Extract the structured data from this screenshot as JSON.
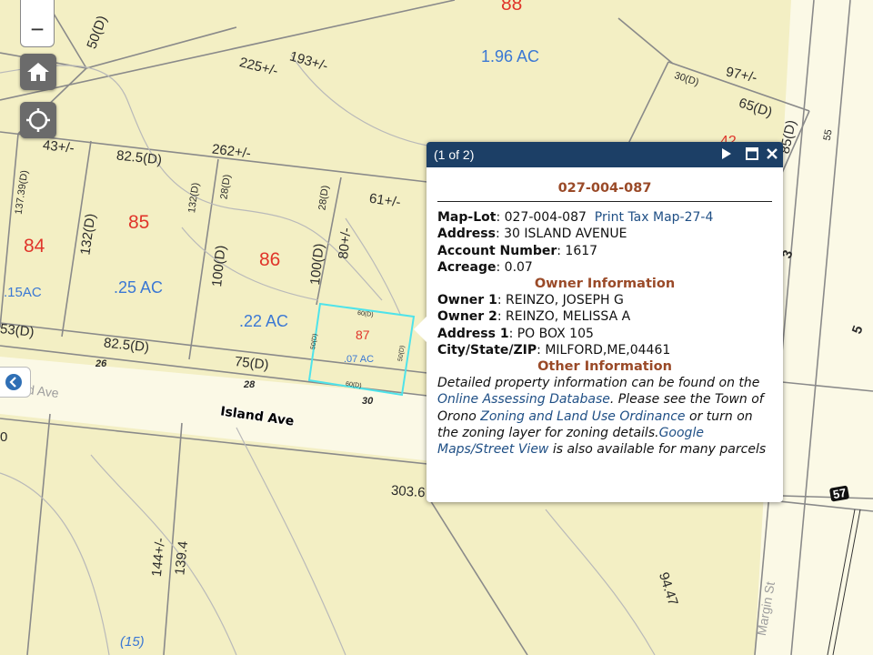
{
  "map": {
    "parcel_numbers": [
      "88",
      "85",
      "84",
      "86",
      "87",
      "42"
    ],
    "acreages": [
      "1.96 AC",
      ".25 AC",
      ".15AC",
      ".22 AC",
      ".07 AC"
    ],
    "dims": {
      "d50": "50(D)",
      "d193": "193+/-",
      "d225": "225+/-",
      "d97": "97+/-",
      "d30": "30(D)",
      "d65": "65(D)",
      "d85": "85(D)",
      "d55": "55",
      "d43": "43+/-",
      "d825a": "82.5(D)",
      "d262": "262+/-",
      "d13739": "137.39(D)",
      "d132a": "132(D)",
      "d132b": "132(D)",
      "d28a": "28(D)",
      "d28b": "28(D)",
      "d61": "61+/-",
      "d100a": "100(D)",
      "d100b": "100(D)",
      "d80": "80+/-",
      "d53": "53(D)",
      "d825b": "82.5(D)",
      "d75": "75(D)",
      "d26": "26",
      "d28c": "28",
      "d30c": "30",
      "d60a": "60(D)",
      "d60b": "60(D)",
      "d50b": "50(D)",
      "d50c": "50(D)",
      "d3036": "303.6",
      "d144": "144+/-",
      "d1394": "139.4",
      "d9447": "94.47",
      "d15": "(15)",
      "d57": "57",
      "d0": "0",
      "d5": "5",
      "d34": "3"
    },
    "streets": {
      "island_ave": "Island Ave",
      "island_ave_faded": "d Ave",
      "margin_st": "Margin St"
    }
  },
  "controls": {
    "zoom_out": "−"
  },
  "popup": {
    "count": "(1 of 2)",
    "title": "027-004-087",
    "fields": {
      "maplot_label": "Map-Lot",
      "maplot_value": ": 027-004-087",
      "print_link": "Print Tax Map-27-4",
      "address_label": "Address",
      "address_value": ": 30 ISLAND AVENUE",
      "account_label": "Account Number",
      "account_value": ": 1617",
      "acreage_label": "Acreage",
      "acreage_value": ": 0.07"
    },
    "owner_heading": "Owner Information",
    "owner": {
      "owner1_label": "Owner 1",
      "owner1_value": ": REINZO, JOSEPH G",
      "owner2_label": "Owner 2",
      "owner2_value": ": REINZO, MELISSA A",
      "addr1_label": "Address 1",
      "addr1_value": ": PO BOX 105",
      "csz_label": "City/State/ZIP",
      "csz_value": ": MILFORD,ME,04461"
    },
    "other_heading": "Other Information",
    "other": {
      "t1": "Detailed property information can be found on the ",
      "link1": "Online Assessing Database",
      "t2": ". Please see the Town of Orono ",
      "link2": "Zoning and Land Use Ordinance",
      "t3": " or turn on the zoning layer for zoning details.",
      "link3": "Google Maps/Street View",
      "t4": " is also available for many parcels"
    }
  },
  "colors": {
    "map_bg": "#f3efc4",
    "parcel_line": "#7a7a7a",
    "lot_number": "#e0352a",
    "acreage": "#3b78d4",
    "highlight": "#4fe3ea",
    "popup_header": "#1c3f66",
    "section_heading": "#9a4a28",
    "link": "#1f4f85"
  }
}
